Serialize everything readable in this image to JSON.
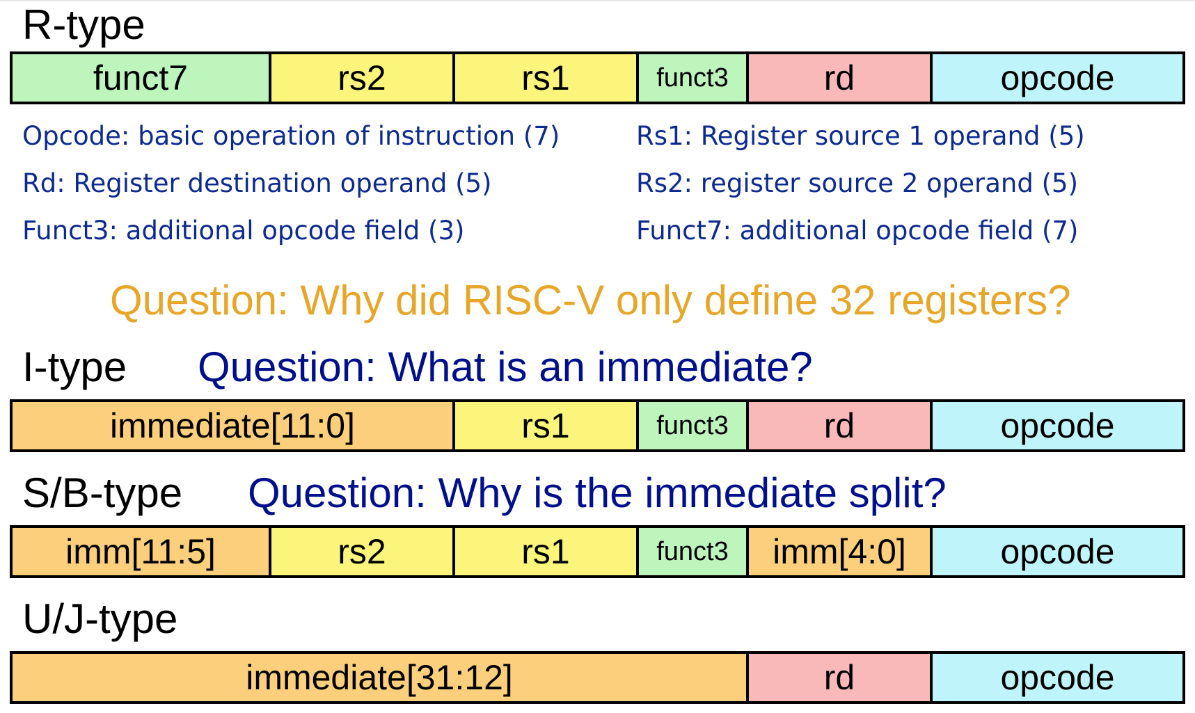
{
  "colors": {
    "funct": "#bdf5bd",
    "reg": "#fbf57c",
    "rd": "#f9b9b8",
    "opcode": "#bff5fa",
    "imm": "#fccf7c",
    "question_blue": "#000f8c",
    "question_orange": "#e8a628",
    "description": "#0d2a91"
  },
  "r_type": {
    "label": "R-type",
    "fields": [
      "funct7",
      "rs2",
      "rs1",
      "funct3",
      "rd",
      "opcode"
    ]
  },
  "descriptions": {
    "opcode": "Opcode: basic operation of instruction (7)",
    "rd": "Rd: Register destination operand (5)",
    "funct3": "Funct3: additional opcode field (3)",
    "rs1": "Rs1: Register source 1 operand (5)",
    "rs2": "Rs2: register source 2 operand (5)",
    "funct7": "Funct7: additional opcode field (7)"
  },
  "question_registers": "Question: Why did RISC-V only define 32 registers?",
  "i_type": {
    "label": "I-type",
    "question": "Question: What is an immediate?",
    "fields": [
      "immediate[11:0]",
      "rs1",
      "funct3",
      "rd",
      "opcode"
    ]
  },
  "sb_type": {
    "label": "S/B-type",
    "question": "Question: Why is the immediate split?",
    "fields": [
      "imm[11:5]",
      "rs2",
      "rs1",
      "funct3",
      "imm[4:0]",
      "opcode"
    ]
  },
  "uj_type": {
    "label": "U/J-type",
    "fields": [
      "immediate[31:12]",
      "rd",
      "opcode"
    ]
  }
}
